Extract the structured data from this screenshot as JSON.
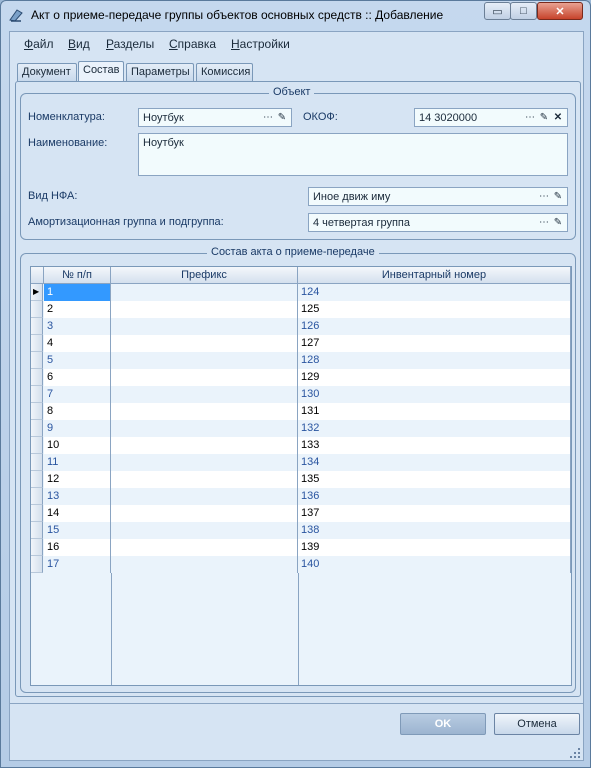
{
  "window": {
    "title": "Акт о приеме-передаче группы объектов основных средств :: Добавление",
    "min_glyph": "▭",
    "max_glyph": "□",
    "close_glyph": "✕"
  },
  "menu": [
    "Файл",
    "Вид",
    "Разделы",
    "Справка",
    "Настройки"
  ],
  "tabs": [
    "Документ",
    "Состав",
    "Параметры",
    "Комиссия"
  ],
  "active_tab": "Состав",
  "object_group": {
    "title": "Объект",
    "nomenclature_label": "Номенклатура:",
    "nomenclature_value": "Ноутбук",
    "okof_label": "ОКОФ:",
    "okof_value": "14 3020000",
    "name_label": "Наименование:",
    "name_value": "Ноутбук",
    "nfa_label": "Вид НФА:",
    "nfa_value": "Иное движ иму",
    "amort_label": "Амортизационная группа и подгруппа:",
    "amort_value": "4 четвертая группа"
  },
  "composition": {
    "title": "Состав акта о приеме-передаче",
    "columns": [
      "№ п/п",
      "Префикс",
      "Инвентарный номер"
    ],
    "rows": [
      {
        "n": "1",
        "prefix": "",
        "inv": "124"
      },
      {
        "n": "2",
        "prefix": "",
        "inv": "125"
      },
      {
        "n": "3",
        "prefix": "",
        "inv": "126"
      },
      {
        "n": "4",
        "prefix": "",
        "inv": "127"
      },
      {
        "n": "5",
        "prefix": "",
        "inv": "128"
      },
      {
        "n": "6",
        "prefix": "",
        "inv": "129"
      },
      {
        "n": "7",
        "prefix": "",
        "inv": "130"
      },
      {
        "n": "8",
        "prefix": "",
        "inv": "131"
      },
      {
        "n": "9",
        "prefix": "",
        "inv": "132"
      },
      {
        "n": "10",
        "prefix": "",
        "inv": "133"
      },
      {
        "n": "11",
        "prefix": "",
        "inv": "134"
      },
      {
        "n": "12",
        "prefix": "",
        "inv": "135"
      },
      {
        "n": "13",
        "prefix": "",
        "inv": "136"
      },
      {
        "n": "14",
        "prefix": "",
        "inv": "137"
      },
      {
        "n": "15",
        "prefix": "",
        "inv": "138"
      },
      {
        "n": "16",
        "prefix": "",
        "inv": "139"
      },
      {
        "n": "17",
        "prefix": "",
        "inv": "140"
      }
    ]
  },
  "buttons": {
    "ok": "OK",
    "cancel": "Отмена"
  },
  "icons": {
    "ellipsis": "⋯",
    "pick": "✎",
    "clear": "✕",
    "row_pointer": "▶"
  }
}
